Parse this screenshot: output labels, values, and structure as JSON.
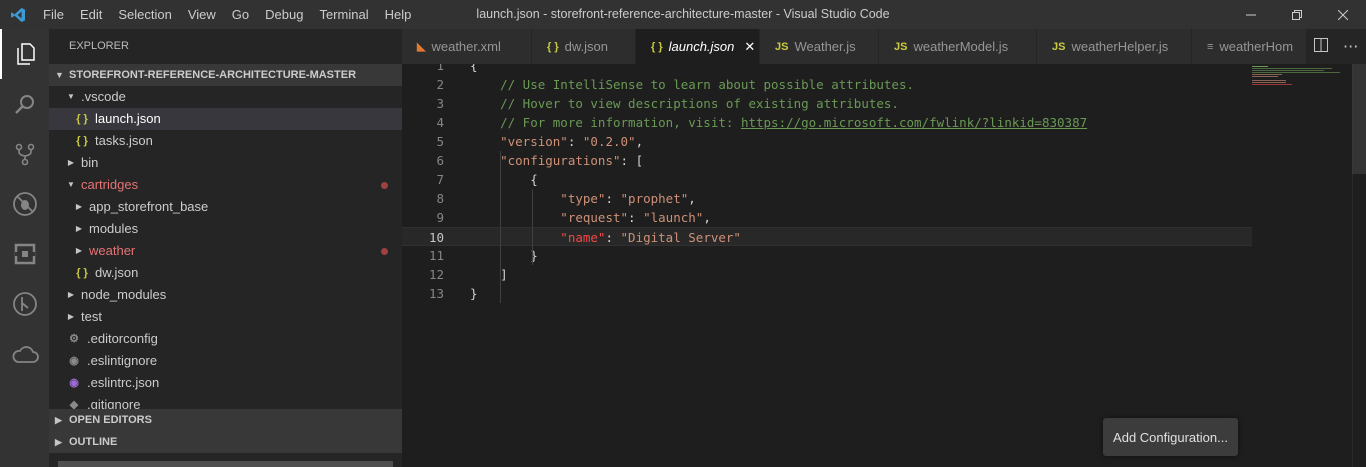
{
  "titlebar": {
    "menu": [
      "File",
      "Edit",
      "Selection",
      "View",
      "Go",
      "Debug",
      "Terminal",
      "Help"
    ],
    "title": "launch.json - storefront-reference-architecture-master - Visual Studio Code"
  },
  "sidebar": {
    "title": "EXPLORER",
    "root": "STOREFRONT-REFERENCE-ARCHITECTURE-MASTER",
    "items": [
      {
        "label": ".vscode",
        "depth": 1,
        "type": "folder",
        "expanded": true
      },
      {
        "label": "launch.json",
        "depth": 2,
        "type": "json",
        "selected": true
      },
      {
        "label": "tasks.json",
        "depth": 2,
        "type": "json"
      },
      {
        "label": "bin",
        "depth": 1,
        "type": "folder",
        "expanded": false
      },
      {
        "label": "cartridges",
        "depth": 1,
        "type": "folder",
        "expanded": true,
        "modified": true
      },
      {
        "label": "app_storefront_base",
        "depth": 2,
        "type": "folder",
        "expanded": false
      },
      {
        "label": "modules",
        "depth": 2,
        "type": "folder",
        "expanded": false
      },
      {
        "label": "weather",
        "depth": 2,
        "type": "folder",
        "expanded": false,
        "modified": true
      },
      {
        "label": "dw.json",
        "depth": 2,
        "type": "json"
      },
      {
        "label": "node_modules",
        "depth": 1,
        "type": "folder",
        "expanded": false
      },
      {
        "label": "test",
        "depth": 1,
        "type": "folder",
        "expanded": false
      },
      {
        "label": ".editorconfig",
        "depth": 1,
        "type": "gear"
      },
      {
        "label": ".eslintignore",
        "depth": 1,
        "type": "circle"
      },
      {
        "label": ".eslintrc.json",
        "depth": 1,
        "type": "eslint"
      },
      {
        "label": ".gitignore",
        "depth": 1,
        "type": "git"
      }
    ],
    "open_editors": "OPEN EDITORS",
    "outline": "OUTLINE"
  },
  "tabs": [
    {
      "label": "weather.xml",
      "icon": "xml"
    },
    {
      "label": "dw.json",
      "icon": "json"
    },
    {
      "label": "launch.json",
      "icon": "json",
      "active": true
    },
    {
      "label": "Weather.js",
      "icon": "js"
    },
    {
      "label": "weatherModel.js",
      "icon": "js"
    },
    {
      "label": "weatherHelper.js",
      "icon": "js"
    },
    {
      "label": "weatherHom",
      "icon": "lines"
    }
  ],
  "editor": {
    "current_line": 10,
    "lines": [
      {
        "n": "1",
        "segs": [
          [
            "punc",
            "{"
          ]
        ]
      },
      {
        "n": "2",
        "segs": [
          [
            "comment",
            "    // Use IntelliSense to learn about possible attributes."
          ]
        ]
      },
      {
        "n": "3",
        "segs": [
          [
            "comment",
            "    // Hover to view descriptions of existing attributes."
          ]
        ]
      },
      {
        "n": "4",
        "segs": [
          [
            "comment",
            "    // For more information, visit: "
          ],
          [
            "link",
            "https://go.microsoft.com/fwlink/?linkid=830387"
          ]
        ]
      },
      {
        "n": "5",
        "segs": [
          [
            "str",
            "    \"version\""
          ],
          [
            "punc",
            ": "
          ],
          [
            "str",
            "\"0.2.0\""
          ],
          [
            "punc",
            ","
          ]
        ]
      },
      {
        "n": "6",
        "segs": [
          [
            "str",
            "    \"configurations\""
          ],
          [
            "punc",
            ": ["
          ]
        ]
      },
      {
        "n": "7",
        "segs": [
          [
            "punc",
            "        {"
          ]
        ]
      },
      {
        "n": "8",
        "segs": [
          [
            "str",
            "            \"type\""
          ],
          [
            "punc",
            ": "
          ],
          [
            "str",
            "\"prophet\""
          ],
          [
            "punc",
            ","
          ]
        ]
      },
      {
        "n": "9",
        "segs": [
          [
            "str",
            "            \"request\""
          ],
          [
            "punc",
            ": "
          ],
          [
            "str",
            "\"launch\""
          ],
          [
            "punc",
            ","
          ]
        ]
      },
      {
        "n": "10",
        "segs": [
          [
            "keyred",
            "            \"name\""
          ],
          [
            "punc",
            ": "
          ],
          [
            "str",
            "\"Digital Server\""
          ]
        ]
      },
      {
        "n": "11",
        "segs": [
          [
            "punc",
            "        }"
          ]
        ]
      },
      {
        "n": "12",
        "segs": [
          [
            "punc",
            "    ]"
          ]
        ]
      },
      {
        "n": "13",
        "segs": [
          [
            "punc",
            "}"
          ]
        ]
      }
    ]
  },
  "add_configuration": "Add Configuration...",
  "colors": {
    "accent": "#007acc",
    "modified": "#e57373",
    "json_icon": "#cbcb41"
  }
}
